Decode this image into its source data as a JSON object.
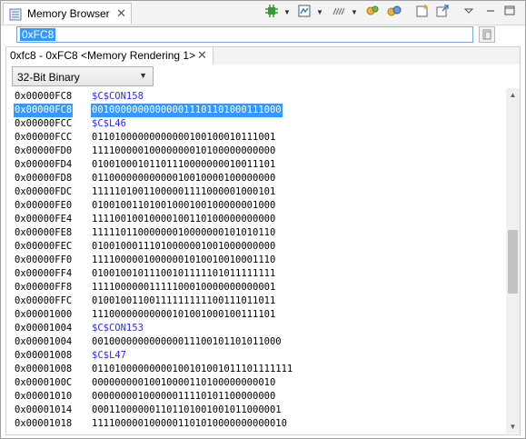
{
  "view": {
    "tab_title": "Memory Browser",
    "close_glyph": "✕"
  },
  "address_bar": {
    "value": "0xFC8"
  },
  "rendering_tab": {
    "title": "0xfc8 - 0xFC8 <Memory Rendering 1>",
    "close_glyph": "✕"
  },
  "format_select": {
    "selected": "32-Bit Binary"
  },
  "memory_rows": [
    {
      "address": "0x00000FC8",
      "value": "$C$CON158",
      "kind": "symbol"
    },
    {
      "address": "0x00000FC8",
      "value": "00100000000000001110110100011100​0",
      "kind": "data",
      "selected": true
    },
    {
      "address": "0x00000FCC",
      "value": "$C$L46",
      "kind": "symbol"
    },
    {
      "address": "0x00000FCC",
      "value": "01101000000000000100100010111001",
      "kind": "data"
    },
    {
      "address": "0x00000FD0",
      "value": "11110000010000000010100000000000",
      "kind": "data"
    },
    {
      "address": "0x00000FD4",
      "value": "01001000101101110000000010011101",
      "kind": "data"
    },
    {
      "address": "0x00000FD8",
      "value": "01100000000000010010000100000000",
      "kind": "data"
    },
    {
      "address": "0x00000FDC",
      "value": "11111010011000001111000001000101",
      "kind": "data"
    },
    {
      "address": "0x00000FE0",
      "value": "01001001101001000100100000001000",
      "kind": "data"
    },
    {
      "address": "0x00000FE4",
      "value": "11110010010000100110100000000000",
      "kind": "data"
    },
    {
      "address": "0x00000FE8",
      "value": "11111011000000010000000101010110",
      "kind": "data"
    },
    {
      "address": "0x00000FEC",
      "value": "01001000111010000001001000000000",
      "kind": "data"
    },
    {
      "address": "0x00000FF0",
      "value": "11110000010000001010010010001110",
      "kind": "data"
    },
    {
      "address": "0x00000FF4",
      "value": "01001001011100101111101011111111",
      "kind": "data"
    },
    {
      "address": "0x00000FF8",
      "value": "11110000001111100010000000000001",
      "kind": "data"
    },
    {
      "address": "0x00000FFC",
      "value": "01001001100111111111100111011011",
      "kind": "data"
    },
    {
      "address": "0x00001000",
      "value": "11100000000000101001000100111101",
      "kind": "data"
    },
    {
      "address": "0x00001004",
      "value": "$C$CON153",
      "kind": "symbol"
    },
    {
      "address": "0x00001004",
      "value": "00100000000000001110010110101100​0",
      "kind": "data"
    },
    {
      "address": "0x00001008",
      "value": "$C$L47",
      "kind": "symbol"
    },
    {
      "address": "0x00001008",
      "value": "01101000000000100101001011101111111",
      "kind": "data"
    },
    {
      "address": "0x0000100C",
      "value": "00000000010010000110100000000010",
      "kind": "data"
    },
    {
      "address": "0x00001010",
      "value": "00000000100000011110101100000000",
      "kind": "data"
    },
    {
      "address": "0x00001014",
      "value": "00011000000110110100100101100000​1",
      "kind": "data"
    },
    {
      "address": "0x00001018",
      "value": "11110000010000011010100000000000​10",
      "kind": "data"
    }
  ],
  "colors": {
    "selection": "#3399ff",
    "symbol_text": "#2a2aff"
  },
  "icons": [
    "memory-browser-icon",
    "chip-icon",
    "new-rendering-icon",
    "connect-icon",
    "toggle-address-icon",
    "link-icon",
    "new-tab-icon",
    "export-icon",
    "view-menu-icon",
    "minimize-icon",
    "maximize-icon",
    "add-watch-icon"
  ]
}
